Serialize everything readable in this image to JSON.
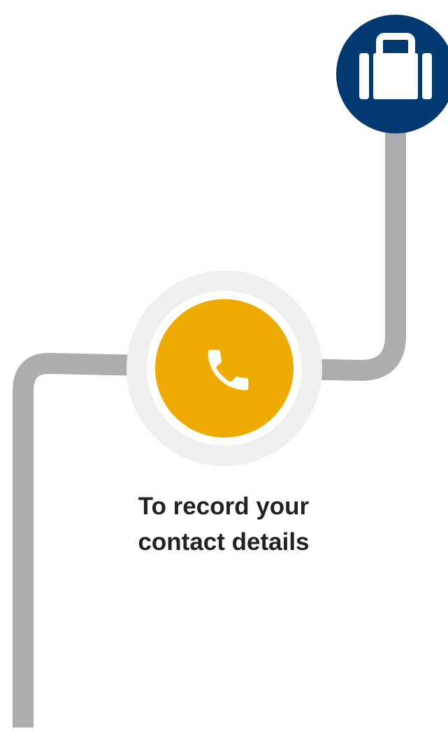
{
  "step": {
    "caption_line1": "To record your",
    "caption_line2": "contact details"
  },
  "nodes": [
    {
      "icon": "briefcase-icon",
      "color": "#003a70"
    },
    {
      "icon": "phone-icon",
      "color": "#efaa00",
      "halo_color": "#efefef"
    }
  ],
  "connector_color": "#adadaf"
}
